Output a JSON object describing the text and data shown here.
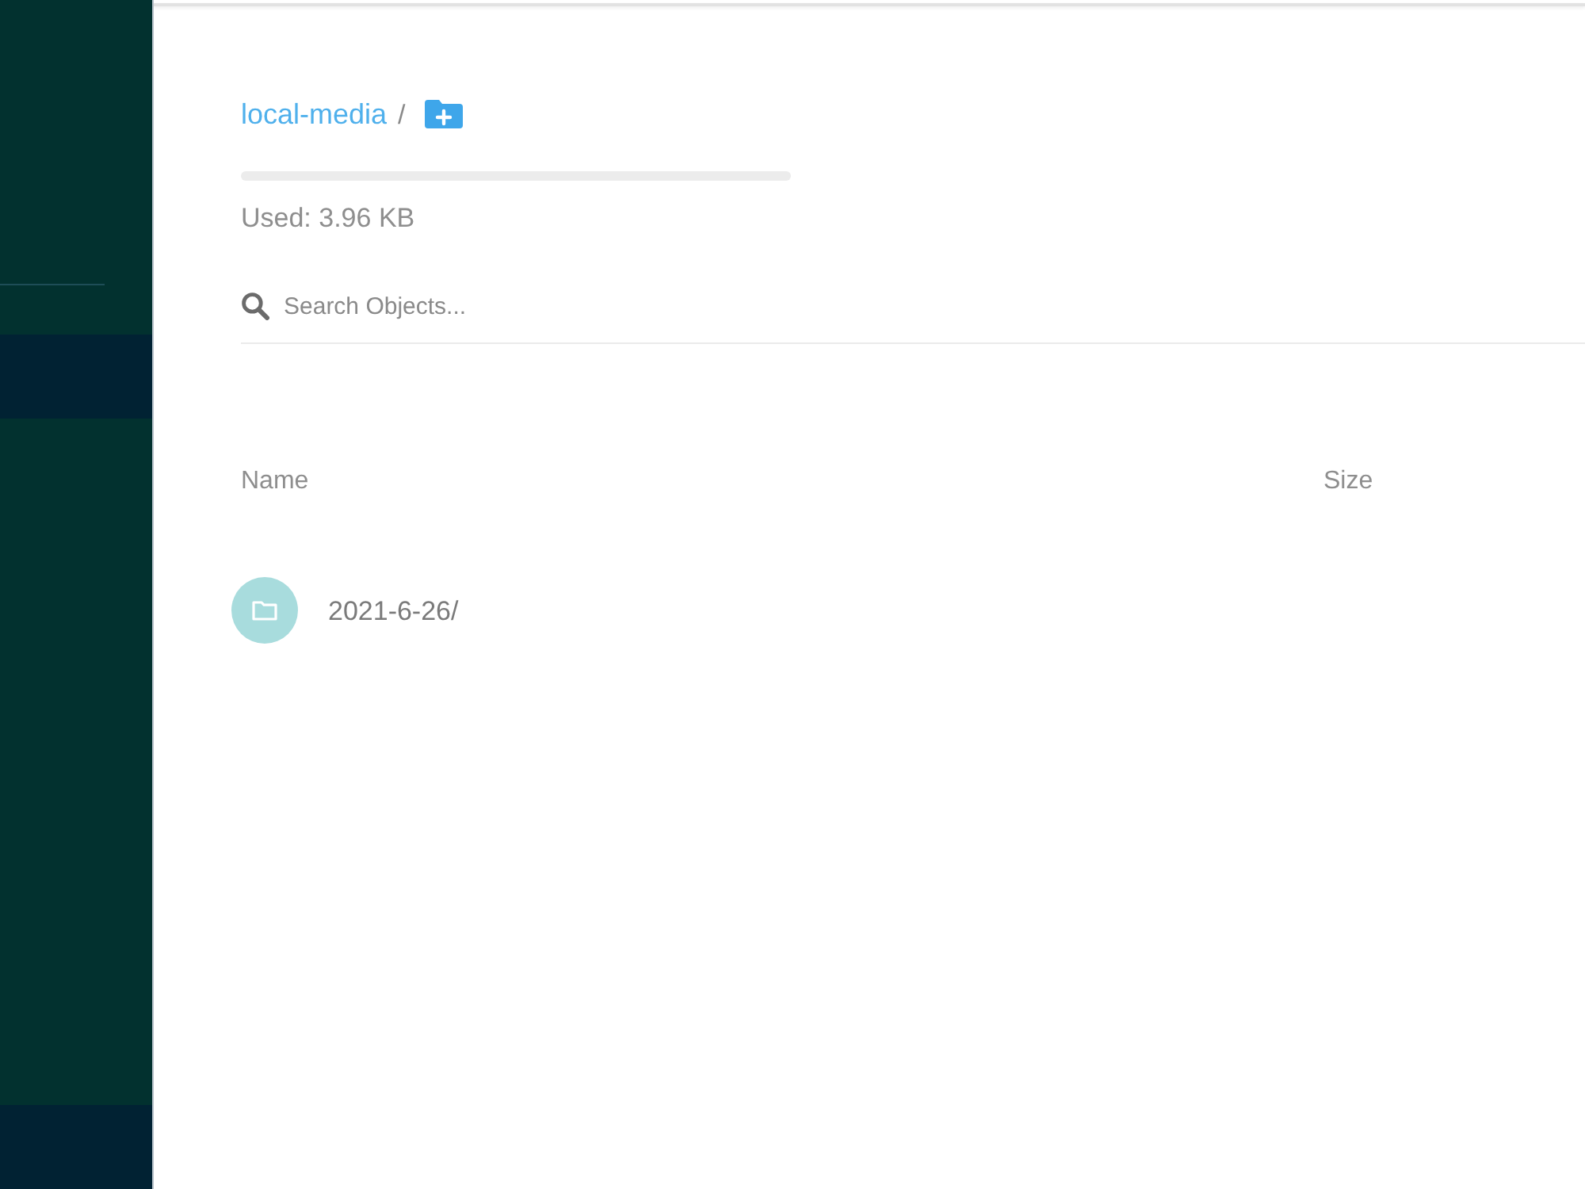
{
  "breadcrumb": {
    "bucket": "local-media",
    "separator": "/"
  },
  "usage": {
    "label": "Used: 3.96 KB"
  },
  "search": {
    "placeholder": "Search Objects..."
  },
  "table": {
    "columns": [
      "Name",
      "Size"
    ],
    "rows": [
      {
        "kind": "folder",
        "name": "2021-6-26/"
      }
    ]
  }
}
